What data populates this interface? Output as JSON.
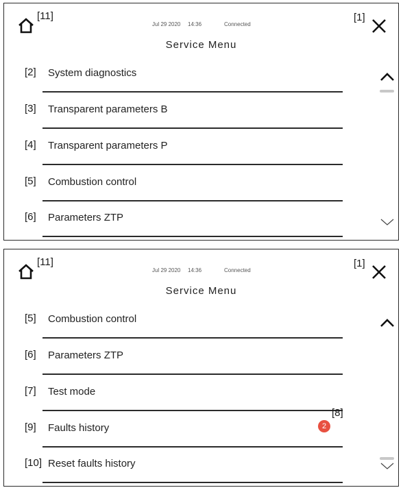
{
  "panel1": {
    "home_marker": "[11]",
    "close_marker": "[1]",
    "date": "Jul 29 2020",
    "time": "14:36",
    "connection": "Connected",
    "title": "Service Menu",
    "items": [
      {
        "marker": "[2]",
        "label": "System diagnostics"
      },
      {
        "marker": "[3]",
        "label": "Transparent parameters B"
      },
      {
        "marker": "[4]",
        "label": "Transparent parameters P"
      },
      {
        "marker": "[5]",
        "label": "Combustion control"
      },
      {
        "marker": "[6]",
        "label": "Parameters ZTP"
      }
    ]
  },
  "panel2": {
    "home_marker": "[11]",
    "close_marker": "[1]",
    "date": "Jul 29 2020",
    "time": "14:36",
    "connection": "Connected",
    "title": "Service Menu",
    "items": [
      {
        "marker": "[5]",
        "label": "Combustion control"
      },
      {
        "marker": "[6]",
        "label": "Parameters ZTP"
      },
      {
        "marker": "[7]",
        "label": "Test mode"
      },
      {
        "marker": "[9]",
        "label": "Faults history"
      },
      {
        "marker": "[10]",
        "label": "Reset faults history"
      }
    ],
    "fault_badge": {
      "count": "2",
      "marker": "[8]"
    }
  },
  "colors": {
    "badge": "#e85040",
    "line": "#2a2a2a",
    "scroll_bar": "#c8c8c8"
  },
  "icons": [
    "home-icon",
    "close-icon",
    "chevron-up-icon",
    "chevron-down-icon"
  ]
}
